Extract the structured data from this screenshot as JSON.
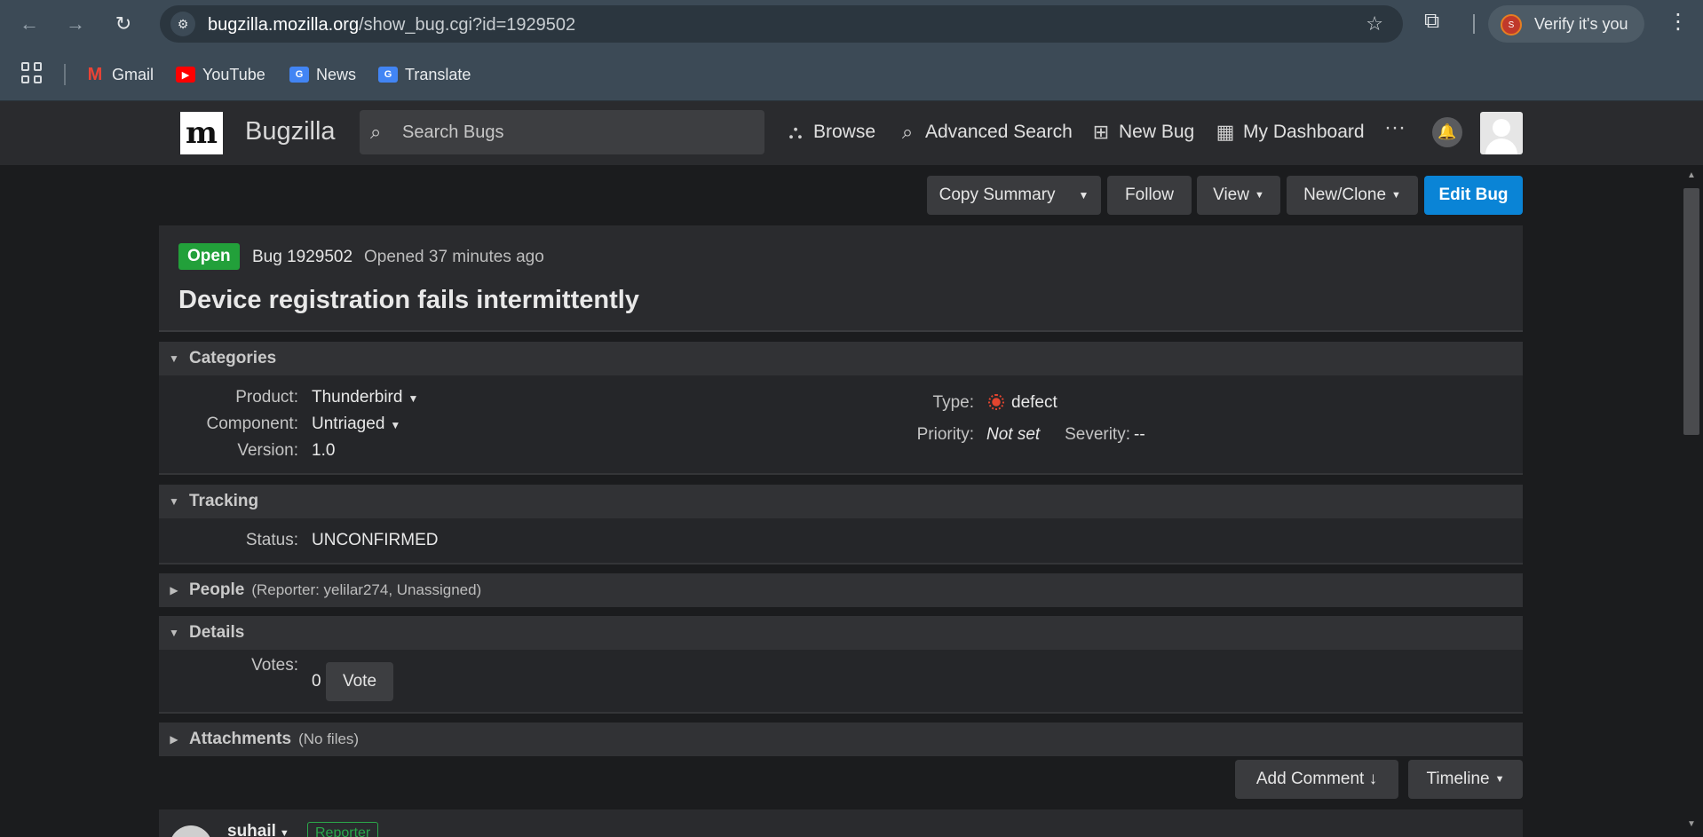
{
  "browser": {
    "url_host": "bugzilla.mozilla.org",
    "url_path": "/show_bug.cgi?id=1929502",
    "profile_label": "Verify it's you",
    "profile_initial": "S",
    "bookmarks": [
      {
        "label": "Gmail"
      },
      {
        "label": "YouTube"
      },
      {
        "label": "News"
      },
      {
        "label": "Translate"
      }
    ]
  },
  "header": {
    "logo_letter": "m",
    "app_name": "Bugzilla",
    "search_placeholder": "Search Bugs",
    "nav": {
      "browse": "Browse",
      "advanced_search": "Advanced Search",
      "new_bug": "New Bug",
      "my_dashboard": "My Dashboard"
    },
    "more": "···"
  },
  "actions": {
    "copy_summary": "Copy Summary",
    "follow": "Follow",
    "view": "View",
    "new_clone": "New/Clone",
    "edit_bug": "Edit Bug"
  },
  "bug": {
    "status_badge": "Open",
    "id_label": "Bug 1929502",
    "opened": "Opened 37 minutes ago",
    "summary": "Device registration fails intermittently"
  },
  "categories": {
    "title": "Categories",
    "product_label": "Product:",
    "product_value": "Thunderbird",
    "component_label": "Component:",
    "component_value": "Untriaged",
    "version_label": "Version:",
    "version_value": "1.0",
    "type_label": "Type:",
    "type_value": "defect",
    "priority_label": "Priority:",
    "priority_value": "Not set",
    "severity_label": "Severity:",
    "severity_value": "--"
  },
  "tracking": {
    "title": "Tracking",
    "status_label": "Status:",
    "status_value": "UNCONFIRMED"
  },
  "people": {
    "title": "People",
    "sub": "(Reporter: yelilar274, Unassigned)"
  },
  "details": {
    "title": "Details",
    "votes_label": "Votes:",
    "votes_value": "0",
    "vote_button": "Vote"
  },
  "attachments": {
    "title": "Attachments",
    "sub": "(No files)"
  },
  "comments": {
    "add_comment": "Add Comment ↓",
    "timeline": "Timeline",
    "first_user": "suhail",
    "first_badge": "Reporter"
  },
  "colors": {
    "accent": "#0a84d6",
    "open_badge": "#22a03a",
    "defect": "#e2452f"
  }
}
